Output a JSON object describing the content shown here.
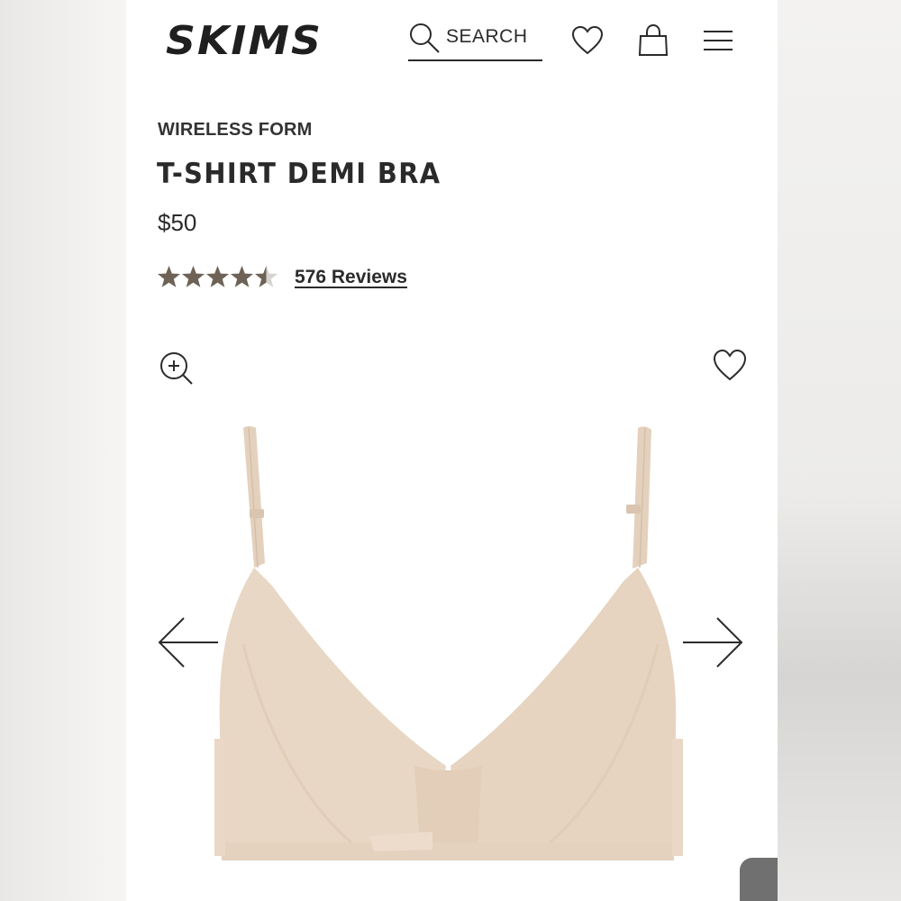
{
  "header": {
    "brand": "SKIMS",
    "search_label": "SEARCH"
  },
  "product": {
    "eyebrow": "WIRELESS FORM",
    "title": "T-SHIRT DEMI BRA",
    "price": "$50",
    "rating_value": 4.5,
    "rating_max": 5,
    "reviews_label": "576 Reviews",
    "image_alt": "nude t-shirt demi bra"
  },
  "colors": {
    "star": "#6e6257",
    "star_empty": "#d8d4cf",
    "product_fabric": "#e7d6c3",
    "text": "#2b2b2b"
  },
  "icons": {
    "search": "search-icon",
    "wishlist": "heart-icon",
    "bag": "shopping-bag-icon",
    "menu": "hamburger-menu-icon",
    "zoom": "zoom-in-icon",
    "prev": "arrow-left-icon",
    "next": "arrow-right-icon"
  }
}
